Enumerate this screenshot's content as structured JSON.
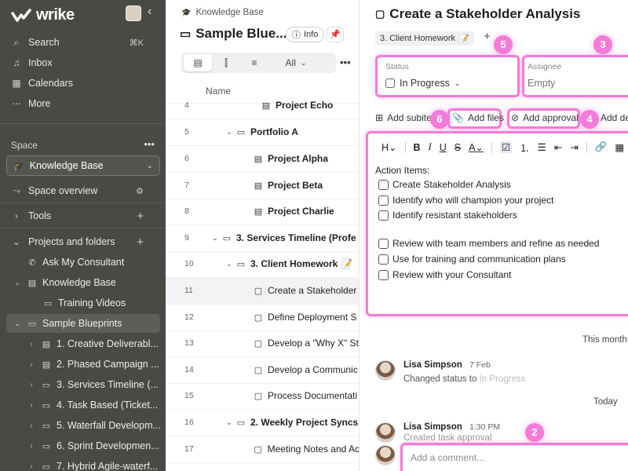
{
  "sidebar": {
    "brand": "wrike",
    "search": "Search",
    "search_shortcut": "⌘K",
    "inbox": "Inbox",
    "calendars": "Calendars",
    "more": "More",
    "space_label": "Space",
    "space_select": "Knowledge Base",
    "space_overview": "Space overview",
    "tools": "Tools",
    "projects_folders": "Projects and folders",
    "tree": [
      {
        "label": "Ask My Consultant",
        "icon": "user-phone-icon"
      },
      {
        "label": "Knowledge Base",
        "icon": "project-icon"
      },
      {
        "label": "Training Videos",
        "icon": "folder-icon"
      },
      {
        "label": "Sample Blueprints",
        "icon": "folder-icon"
      },
      {
        "label": "1. Creative Deliverabl...",
        "icon": "project-icon"
      },
      {
        "label": "2. Phased Campaign ...",
        "icon": "project-icon"
      },
      {
        "label": "3. Services Timeline (...",
        "icon": "folder-icon"
      },
      {
        "label": "4. Task Based (Ticket...",
        "icon": "folder-icon"
      },
      {
        "label": "5. Waterfall Developm...",
        "icon": "folder-icon"
      },
      {
        "label": "6. Sprint Developmen...",
        "icon": "folder-icon"
      },
      {
        "label": "7. Hybrid Agile-waterf...",
        "icon": "folder-icon"
      }
    ]
  },
  "middle": {
    "breadcrumb": "Knowledge Base",
    "title": "Sample Blueprints",
    "title_display": "Sample Blue...",
    "info_label": "Info",
    "view_filter": "All",
    "column_name": "Name",
    "rows": [
      {
        "num": "4",
        "label": "Project Echo"
      },
      {
        "num": "5",
        "label": "Portfolio A"
      },
      {
        "num": "6",
        "label": "Project Alpha"
      },
      {
        "num": "7",
        "label": "Project Beta"
      },
      {
        "num": "8",
        "label": "Project Charlie"
      },
      {
        "num": "9",
        "label": "3. Services Timeline (Profe"
      },
      {
        "num": "10",
        "label": "3. Client Homework"
      },
      {
        "num": "11",
        "label": "Create a Stakeholder"
      },
      {
        "num": "12",
        "label": "Define Deployment S"
      },
      {
        "num": "13",
        "label": "Develop a \"Why X\" St"
      },
      {
        "num": "14",
        "label": "Develop a Communic"
      },
      {
        "num": "15",
        "label": "Process Documentati"
      },
      {
        "num": "16",
        "label": "2. Weekly Project Syncs"
      },
      {
        "num": "17",
        "label": "Meeting Notes and Ac"
      }
    ]
  },
  "task": {
    "title": "Create a Stakeholder Analysis",
    "parent_tag": "3. Client Homework",
    "status_label": "Status",
    "status_value": "In Progress",
    "assignee_label": "Assignee",
    "assignee_value": "Empty",
    "add_subitem": "Add subite",
    "add_files": "Add files",
    "add_approval": "Add approval",
    "add_dep": "Add de",
    "editor_heading": "H",
    "action_items": "Action Items:",
    "checklist": [
      "Create Stakeholder Analysis",
      "Identify who will champion your project",
      "Identify resistant stakeholders",
      "Review with team members and refine as needed",
      "Use for training and communication plans",
      "Review with your Consultant"
    ],
    "this_month": "This month",
    "today": "Today",
    "comments": [
      {
        "author": "Lisa Simpson",
        "time": "7 Feb",
        "body": "Changed status to",
        "status": "In Progress"
      },
      {
        "author": "Lisa Simpson",
        "time": "1:30 PM",
        "body": "Created task approval"
      }
    ],
    "comment_placeholder": "Add a comment..."
  },
  "annotations": [
    "2",
    "3",
    "4",
    "5",
    "6"
  ],
  "colors": {
    "highlight": "#f47bd8",
    "sidebar_bg": "#4a4a45",
    "brand_accent": "#c0399e"
  }
}
